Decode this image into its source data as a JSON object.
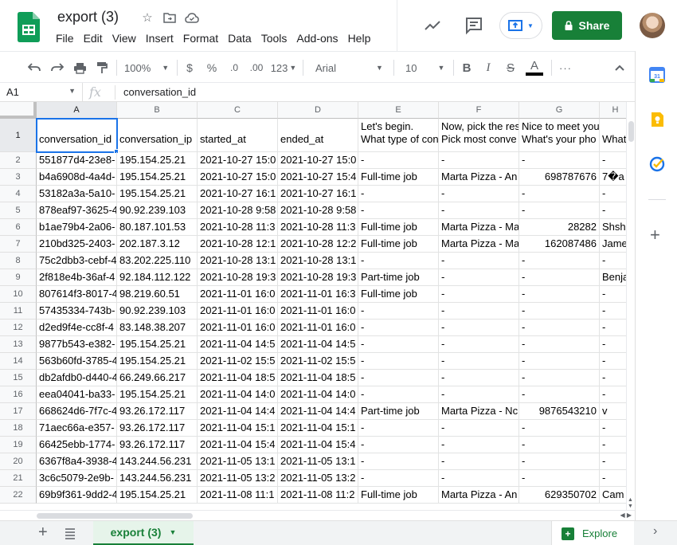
{
  "doc": {
    "title": "export (3)"
  },
  "menu": [
    "File",
    "Edit",
    "View",
    "Insert",
    "Format",
    "Data",
    "Tools",
    "Add-ons",
    "Help"
  ],
  "header": {
    "share_label": "Share"
  },
  "toolbar": {
    "zoom": "100%",
    "currency": "$",
    "percent": "%",
    "decimal_decrease": ".0",
    "decimal_increase": ".00",
    "more_formats": "123",
    "font": "Arial",
    "font_size": "10",
    "bold": "B",
    "italic": "I",
    "strike": "S",
    "text_color": "A",
    "more": "···"
  },
  "formula_bar": {
    "cell_ref": "A1",
    "fx": "fx",
    "value": "conversation_id"
  },
  "columns": [
    "A",
    "B",
    "C",
    "D",
    "E",
    "F",
    "G",
    "H"
  ],
  "rows": [
    "1",
    "2",
    "3",
    "4",
    "5",
    "6",
    "7",
    "8",
    "9",
    "10",
    "11",
    "12",
    "13",
    "14",
    "15",
    "16",
    "17",
    "18",
    "19",
    "20",
    "21",
    "22"
  ],
  "header_row": [
    "conversation_id",
    "conversation_ip",
    "started_at",
    "ended_at",
    "Let's begin.\nWhat type of con",
    "Now, pick the res\nPick most conve",
    "Nice to meet you\nWhat's your pho",
    "\nWhat"
  ],
  "data_rows": [
    [
      "551877d4-23e8-",
      "195.154.25.21",
      "2021-10-27 15:0",
      "2021-10-27 15:0",
      "-",
      "-",
      "-",
      "-"
    ],
    [
      "b4a6908d-4a4d-",
      "195.154.25.21",
      "2021-10-27 15:0",
      "2021-10-27 15:4",
      "Full-time job",
      "Marta Pizza - An",
      "698787676",
      "7�a"
    ],
    [
      "53182a3a-5a10-",
      "195.154.25.21",
      "2021-10-27 16:1",
      "2021-10-27 16:1",
      "-",
      "-",
      "-",
      "-"
    ],
    [
      "878eaf97-3625-4",
      "90.92.239.103",
      "2021-10-28 9:58",
      "2021-10-28 9:58",
      "-",
      "-",
      "-",
      "-"
    ],
    [
      "b1ae79b4-2a06-",
      "80.187.101.53",
      "2021-10-28 11:3",
      "2021-10-28 11:3",
      "Full-time job",
      "Marta Pizza - Ma",
      "28282",
      "Shsh"
    ],
    [
      "210bd325-2403-",
      "202.187.3.12",
      "2021-10-28 12:1",
      "2021-10-28 12:2",
      "Full-time job",
      "Marta Pizza - Ma",
      "162087486",
      "Jame"
    ],
    [
      "75c2dbb3-cebf-4",
      "83.202.225.110",
      "2021-10-28 13:1",
      "2021-10-28 13:1",
      "-",
      "-",
      "-",
      "-"
    ],
    [
      "2f818e4b-36af-4",
      "92.184.112.122",
      "2021-10-28 19:3",
      "2021-10-28 19:3",
      "Part-time job",
      "-",
      "-",
      "Benja"
    ],
    [
      "807614f3-8017-4",
      "98.219.60.51",
      "2021-11-01 16:0",
      "2021-11-01 16:3",
      "Full-time job",
      "-",
      "-",
      "-"
    ],
    [
      "57435334-743b-",
      "90.92.239.103",
      "2021-11-01 16:0",
      "2021-11-01 16:0",
      "-",
      "-",
      "-",
      "-"
    ],
    [
      "d2ed9f4e-cc8f-4",
      "83.148.38.207",
      "2021-11-01 16:0",
      "2021-11-01 16:0",
      "-",
      "-",
      "-",
      "-"
    ],
    [
      "9877b543-e382-",
      "195.154.25.21",
      "2021-11-04 14:5",
      "2021-11-04 14:5",
      "-",
      "-",
      "-",
      "-"
    ],
    [
      "563b60fd-3785-4",
      "195.154.25.21",
      "2021-11-02 15:5",
      "2021-11-02 15:5",
      "-",
      "-",
      "-",
      "-"
    ],
    [
      "db2afdb0-d440-4",
      "66.249.66.217",
      "2021-11-04 18:5",
      "2021-11-04 18:5",
      "-",
      "-",
      "-",
      "-"
    ],
    [
      "eea04041-ba33-",
      "195.154.25.21",
      "2021-11-04 14:0",
      "2021-11-04 14:0",
      "-",
      "-",
      "-",
      "-"
    ],
    [
      "668624d6-7f7c-4",
      "93.26.172.117",
      "2021-11-04 14:4",
      "2021-11-04 14:4",
      "Part-time job",
      "Marta Pizza - Nc",
      "9876543210",
      "v"
    ],
    [
      "71aec66a-e357-",
      "93.26.172.117",
      "2021-11-04 15:1",
      "2021-11-04 15:1",
      "-",
      "-",
      "-",
      "-"
    ],
    [
      "66425ebb-1774-",
      "93.26.172.117",
      "2021-11-04 15:4",
      "2021-11-04 15:4",
      "-",
      "-",
      "-",
      "-"
    ],
    [
      "6367f8a4-3938-4",
      "143.244.56.231",
      "2021-11-05 13:1",
      "2021-11-05 13:1",
      "-",
      "-",
      "-",
      "-"
    ],
    [
      "3c6c5079-2e9b-",
      "143.244.56.231",
      "2021-11-05 13:2",
      "2021-11-05 13:2",
      "-",
      "-",
      "-",
      "-"
    ],
    [
      "69b9f361-9dd2-4",
      "195.154.25.21",
      "2021-11-08 11:1",
      "2021-11-08 11:2",
      "Full-time job",
      "Marta Pizza - An",
      "629350702",
      "Cam"
    ]
  ],
  "sheet": {
    "tab_label": "export (3)"
  },
  "explore": {
    "label": "Explore"
  },
  "colors": {
    "accent_green": "#188038",
    "selection_blue": "#1a73e8"
  }
}
